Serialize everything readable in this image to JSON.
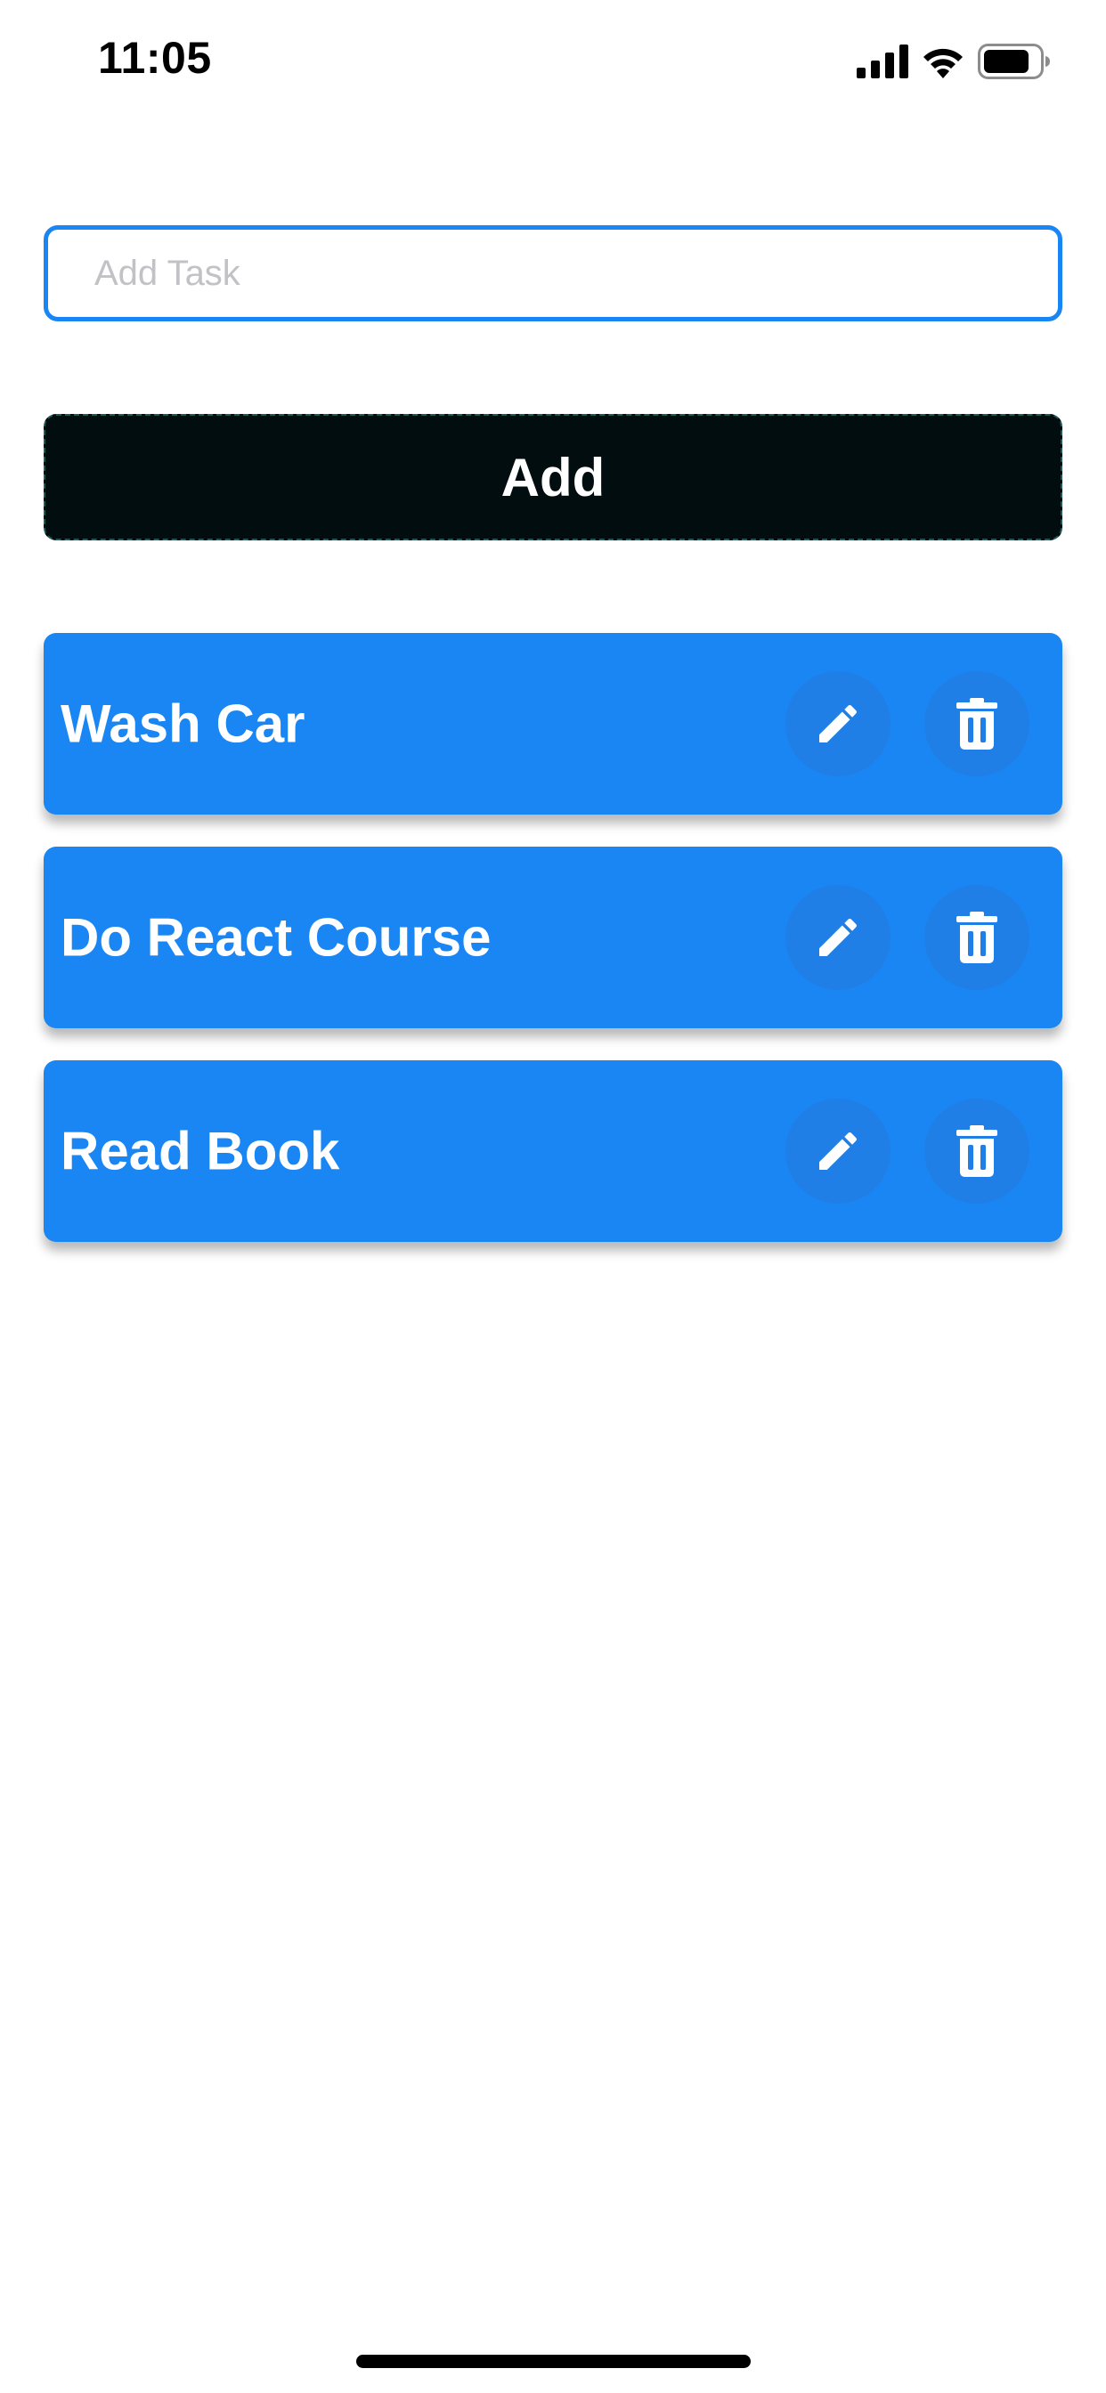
{
  "status_bar": {
    "time": "11:05",
    "icons": [
      "cellular-signal-icon",
      "wifi-icon",
      "battery-icon"
    ]
  },
  "task_input": {
    "placeholder": "Add Task",
    "value": ""
  },
  "add_button": {
    "label": "Add"
  },
  "tasks": [
    {
      "title": "Wash Car",
      "actions": [
        "pencil-icon",
        "trash-icon"
      ]
    },
    {
      "title": "Do React Course",
      "actions": [
        "pencil-icon",
        "trash-icon"
      ]
    },
    {
      "title": "Read Book",
      "actions": [
        "pencil-icon",
        "trash-icon"
      ]
    }
  ],
  "colors": {
    "accent": "#1a86f4",
    "button_background": "#020d0f",
    "text_on_accent": "#ffffff",
    "placeholder": "#c2c2c6"
  }
}
